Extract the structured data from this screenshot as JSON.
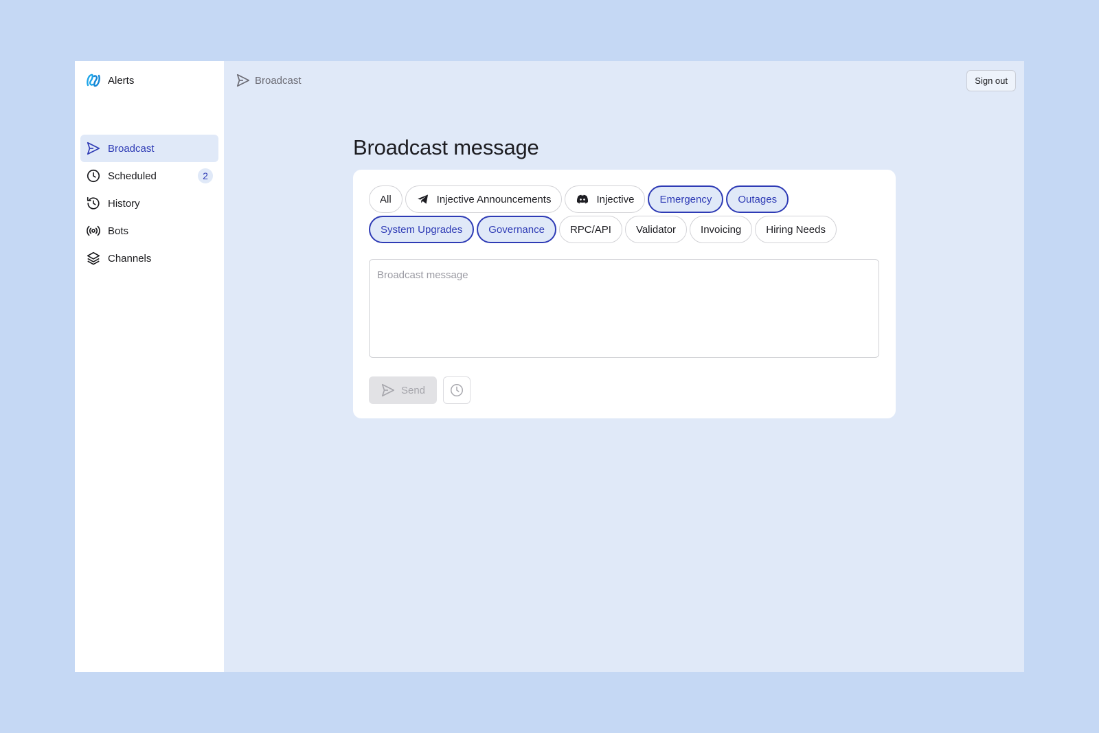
{
  "app": {
    "name": "Alerts"
  },
  "sidebar": {
    "items": [
      {
        "label": "Broadcast",
        "icon": "send-icon",
        "active": true
      },
      {
        "label": "Scheduled",
        "icon": "clock-icon",
        "badge": "2"
      },
      {
        "label": "History",
        "icon": "history-icon"
      },
      {
        "label": "Bots",
        "icon": "broadcast-signal-icon"
      },
      {
        "label": "Channels",
        "icon": "layers-icon"
      }
    ]
  },
  "header": {
    "breadcrumb": "Broadcast",
    "signout_label": "Sign out"
  },
  "main": {
    "title": "Broadcast message",
    "channels": [
      {
        "label": "All",
        "selected": false
      },
      {
        "label": "Injective Announcements",
        "icon": "telegram-icon",
        "selected": false
      },
      {
        "label": "Injective",
        "icon": "discord-icon",
        "selected": false
      },
      {
        "label": "Emergency",
        "selected": true
      },
      {
        "label": "Outages",
        "selected": true
      },
      {
        "label": "System Upgrades",
        "selected": true
      },
      {
        "label": "Governance",
        "selected": true
      },
      {
        "label": "RPC/API",
        "selected": false
      },
      {
        "label": "Validator",
        "selected": false
      },
      {
        "label": "Invoicing",
        "selected": false
      },
      {
        "label": "Hiring Needs",
        "selected": false
      }
    ],
    "message_placeholder": "Broadcast message",
    "message_value": "",
    "send_label": "Send",
    "schedule_icon": "clock-icon"
  },
  "colors": {
    "accent": "#2e3bb5",
    "accent_bg": "#e0e9f8",
    "page_bg": "#c5d8f4",
    "disabled_bg": "#e2e2e5"
  }
}
